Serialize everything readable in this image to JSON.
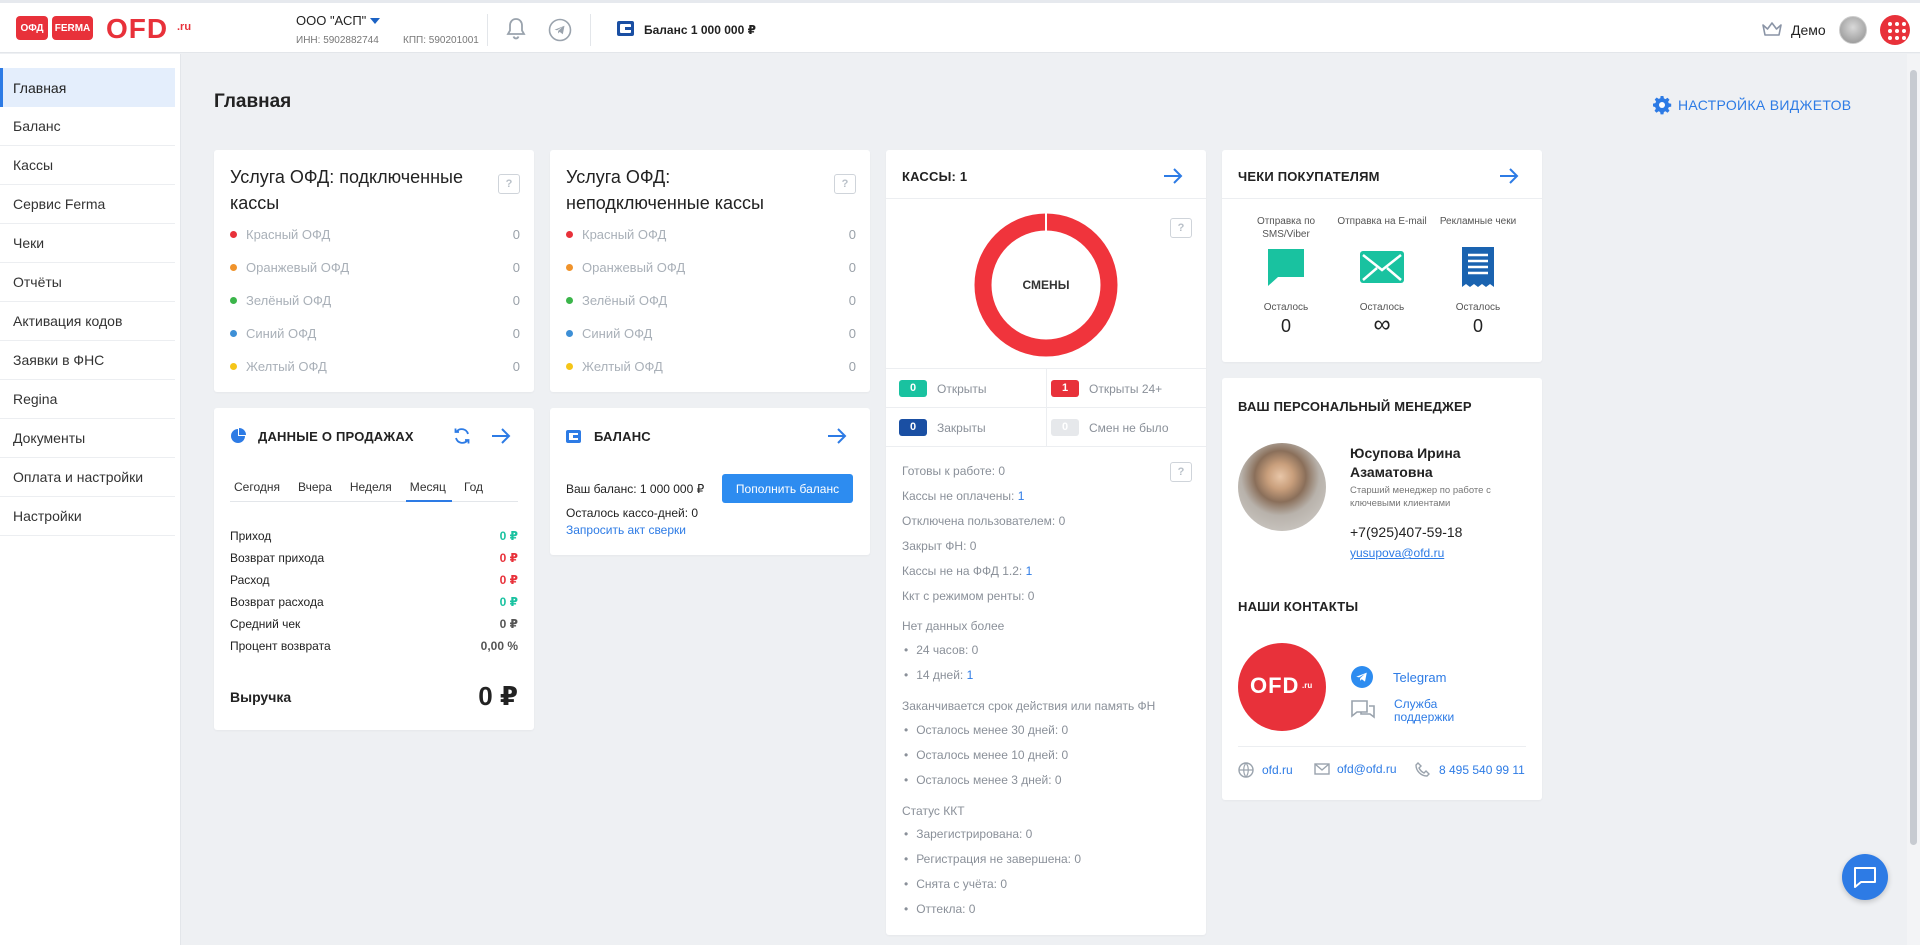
{
  "header": {
    "logo_badge_1": "ОФД",
    "logo_badge_2": "FERMA",
    "logo_text": "OFD",
    "logo_suffix": ".ru",
    "org_name": "ООО \"АСП\"",
    "inn": "ИНН: 5902882744",
    "kpp": "КПП: 590201001",
    "balance": "Баланс 1 000 000 ₽",
    "user": "Демо"
  },
  "sidebar": {
    "items": [
      {
        "label": "Главная"
      },
      {
        "label": "Баланс"
      },
      {
        "label": "Кассы"
      },
      {
        "label": "Сервис Ferma"
      },
      {
        "label": "Чеки"
      },
      {
        "label": "Отчёты"
      },
      {
        "label": "Активация кодов"
      },
      {
        "label": "Заявки в ФНС"
      },
      {
        "label": "Regina"
      },
      {
        "label": "Документы"
      },
      {
        "label": "Оплата и настройки"
      },
      {
        "label": "Настройки"
      }
    ]
  },
  "page": {
    "title": "Главная",
    "widgets_button": "НАСТРОЙКА ВИДЖЕТОВ"
  },
  "connected": {
    "title": "Услуга ОФД: подключенные кассы",
    "rows": [
      {
        "label": "Красный ОФД",
        "value": "0",
        "color": "#e8313a"
      },
      {
        "label": "Оранжевый ОФД",
        "value": "0",
        "color": "#f0932b"
      },
      {
        "label": "Зелёный ОФД",
        "value": "0",
        "color": "#3bb54a"
      },
      {
        "label": "Синий ОФД",
        "value": "0",
        "color": "#3d8fd6"
      },
      {
        "label": "Желтый ОФД",
        "value": "0",
        "color": "#f5c518"
      }
    ]
  },
  "not_connected": {
    "title": "Услуга ОФД: неподключенные кассы",
    "rows": [
      {
        "label": "Красный ОФД",
        "value": "0",
        "color": "#e8313a"
      },
      {
        "label": "Оранжевый ОФД",
        "value": "0",
        "color": "#f0932b"
      },
      {
        "label": "Зелёный ОФД",
        "value": "0",
        "color": "#3bb54a"
      },
      {
        "label": "Синий ОФД",
        "value": "0",
        "color": "#3d8fd6"
      },
      {
        "label": "Желтый ОФД",
        "value": "0",
        "color": "#f5c518"
      }
    ]
  },
  "sales": {
    "title": "ДАННЫЕ О ПРОДАЖАХ",
    "tabs": [
      "Сегодня",
      "Вчера",
      "Неделя",
      "Месяц",
      "Год"
    ],
    "active_tab": "Месяц",
    "rows": [
      {
        "label": "Приход",
        "value": "0 ₽"
      },
      {
        "label": "Возврат прихода",
        "value": "0 ₽"
      },
      {
        "label": "Расход",
        "value": "0 ₽"
      },
      {
        "label": "Возврат расхода",
        "value": "0 ₽"
      },
      {
        "label": "Средний чек",
        "value": "0 ₽"
      },
      {
        "label": "Процент возврата",
        "value": "0,00 %"
      }
    ],
    "revenue_label": "Выручка",
    "revenue_value": "0 ₽"
  },
  "balance": {
    "title": "БАЛАНС",
    "your_balance": "Ваш баланс: 1 000 000 ₽",
    "days_left": "Осталось кассо-дней: 0",
    "reconcile_link": "Запросить акт сверки",
    "topup_button": "Пополнить баланс"
  },
  "kassy": {
    "title": "КАССЫ: 1",
    "donut_label": "СМЕНЫ",
    "donut_color": "#f0343c",
    "shifts": {
      "open": {
        "count": "0",
        "label": "Открыты"
      },
      "open24": {
        "count": "1",
        "label": "Открыты 24+"
      },
      "closed": {
        "count": "0",
        "label": "Закрыты"
      },
      "none": {
        "count": "0",
        "label": "Смен не было"
      }
    },
    "ready": "Готовы к работе: 0",
    "unpaid": "Кассы не оплачены:",
    "unpaid_val": "1",
    "disabled": "Отключена пользователем: 0",
    "fn_closed": "Закрыт ФН: 0",
    "not_ffd": "Кассы не на ФФД 1.2:",
    "not_ffd_val": "1",
    "rent": "Ккт с режимом ренты: 0",
    "no_data_title": "Нет данных более",
    "no_data_24h": "24 часов: 0",
    "no_data_14d": "14 дней:",
    "no_data_14d_val": "1",
    "expiry_title": "Заканчивается срок действия или память ФН",
    "expiry_30": "Осталось менее 30 дней: 0",
    "expiry_10": "Осталось менее 10 дней: 0",
    "expiry_3": "Осталось менее 3 дней: 0",
    "status_title": "Статус ККТ",
    "registered": "Зарегистрирована: 0",
    "reg_incomplete": "Регистрация не завершена: 0",
    "deregistered": "Снята с учёта: 0",
    "ottekla": "Оттекла: 0"
  },
  "receipts": {
    "title": "ЧЕКИ ПОКУПАТЕЛЯМ",
    "sms_label": "Отправка по SMS/Viber",
    "email_label": "Отправка на E-mail",
    "promo_label": "Рекламные чеки",
    "left_label": "Осталось",
    "sms_value": "0",
    "email_value": "∞",
    "promo_value": "0"
  },
  "manager": {
    "title": "ВАШ ПЕРСОНАЛЬНЫЙ МЕНЕДЖЕР",
    "name": "Юсупова Ирина Азаматовна",
    "role": "Старший менеджер по работе с ключевыми клиентами",
    "phone": "+7(925)407-59-18",
    "email": "yusupova@ofd.ru"
  },
  "contacts": {
    "title": "НАШИ КОНТАКТЫ",
    "logo_text": "OFD",
    "logo_suffix": ".ru",
    "telegram": "Telegram",
    "support": "Служба поддержки",
    "site": "ofd.ru",
    "email": "ofd@ofd.ru",
    "phone": "8 495 540 99 11"
  },
  "colors": {
    "accent": "#2d7be5",
    "brand_red": "#e8313a",
    "green": "#19c2a0",
    "navy": "#1a4fa3"
  }
}
